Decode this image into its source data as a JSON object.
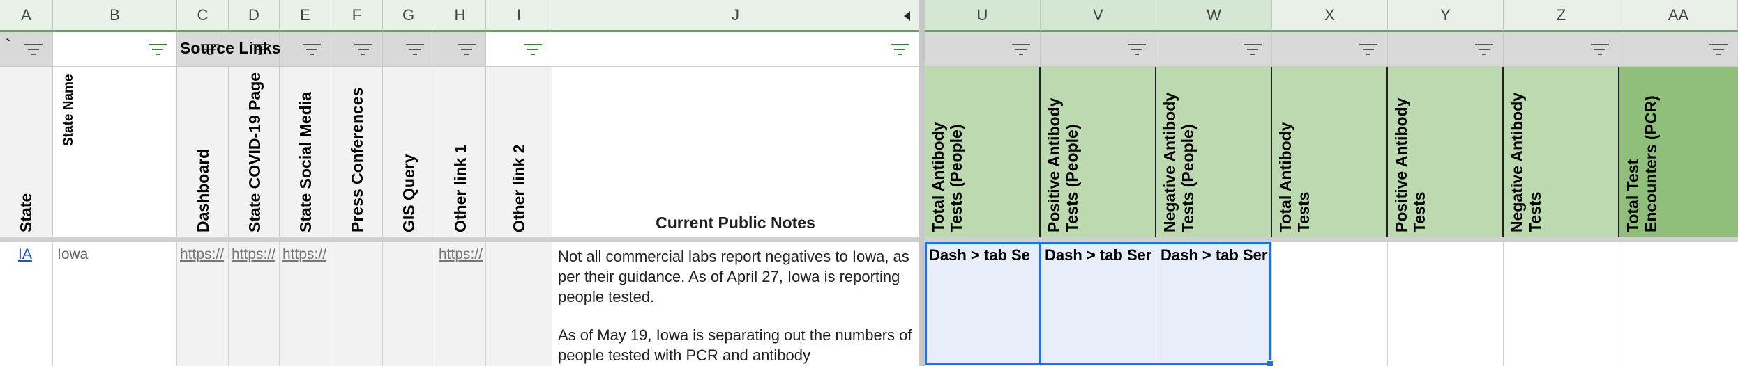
{
  "columns": {
    "A": "A",
    "B": "B",
    "C": "C",
    "D": "D",
    "E": "E",
    "F": "F",
    "G": "G",
    "H": "H",
    "I": "I",
    "J": "J",
    "U": "U",
    "V": "V",
    "W": "W",
    "X": "X",
    "Y": "Y",
    "Z": "Z",
    "AA": "AA"
  },
  "filter_row": {
    "a_text": "`",
    "group_label": "Source Links"
  },
  "headers": {
    "state": "State",
    "state_name": "State Name",
    "dashboard": "Dashboard",
    "covid_page": "State COVID-19 Page",
    "social_media": "State Social Media",
    "press": "Press Conferences",
    "gis": "GIS Query",
    "other1": "Other link 1",
    "other2": "Other link 2",
    "notes": "Current Public Notes",
    "u_line1": "Total Antibody",
    "u_line2": "Tests (People)",
    "v_line1": "Positive Antibody",
    "v_line2": "Tests (People)",
    "w_line1": "Negative Antibody",
    "w_line2": "Tests (People)",
    "x_line1": "Total Antibody",
    "x_line2": "Tests",
    "y_line1": "Positive Antibody",
    "y_line2": "Tests",
    "z_line1": "Negative Antibody",
    "z_line2": "Tests",
    "aa_line1": "Total Test",
    "aa_line2": "Encounters (PCR)"
  },
  "row": {
    "state": "IA",
    "state_name": "Iowa",
    "dashboard_link": "https://",
    "covid_page_link": "https://",
    "social_media_link": "https://",
    "other1_link": "https://",
    "notes_p1": "Not all commercial labs report negatives to Iowa, as per their guidance. As of April 27, Iowa is reporting people tested.",
    "notes_p2": "As of May 19, Iowa is separating out the numbers of people tested with PCR and antibody",
    "u_value": "Dash > tab Se",
    "v_value": "Dash > tab Ser",
    "w_value": "Dash > tab Ser"
  },
  "colors": {
    "header_green": "#bcd9b0",
    "link_blue": "#1a55c8",
    "selection_blue": "#1a73e8"
  }
}
